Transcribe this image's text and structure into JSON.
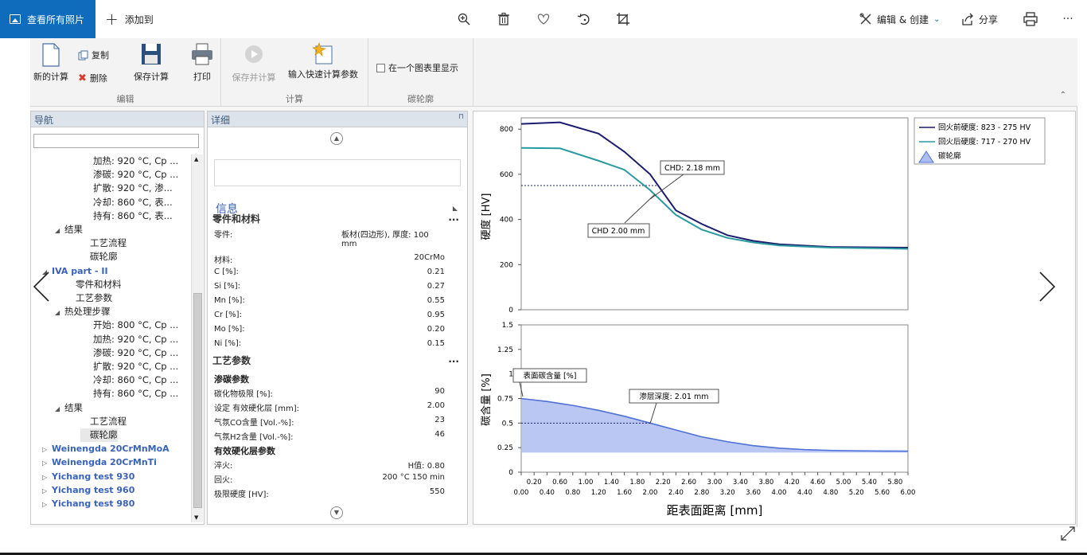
{
  "viewer": {
    "view_all_label": "查看所有照片",
    "add_to_label": "添加到",
    "edit_create_label": "编辑 & 创建",
    "share_label": "分享",
    "more_label": "···"
  },
  "ribbon": {
    "new_calc": "新的计算",
    "copy": "复制",
    "delete": "删除",
    "save_calc": "保存计算",
    "print": "打印",
    "save_and_calc": "保存并计算",
    "quick_params": "输入快速计算参数",
    "one_chart": "在一个图表里显示",
    "group_edit": "编辑",
    "group_calc": "计算",
    "group_profile": "碳轮廓"
  },
  "nav": {
    "title": "导航",
    "rows": [
      {
        "label": "加热: 920 °C,  Cp ...",
        "indent": 80,
        "tri": ""
      },
      {
        "label": "渗碳: 920 °C,  Cp ...",
        "indent": 80,
        "tri": ""
      },
      {
        "label": "扩散: 920 °C,  渗...",
        "indent": 80,
        "tri": ""
      },
      {
        "label": "冷却: 860 °C,  表...",
        "indent": 80,
        "tri": ""
      },
      {
        "label": "持有: 860 °C,  表...",
        "indent": 80,
        "tri": ""
      },
      {
        "label": "结果",
        "indent": 44,
        "tri": "◢"
      },
      {
        "label": "工艺流程",
        "indent": 76,
        "tri": ""
      },
      {
        "label": "碳轮廓",
        "indent": 76,
        "tri": ""
      },
      {
        "label": "IVA part - II",
        "indent": 28,
        "tri": "◢",
        "proj": true
      },
      {
        "label": "零件和材料",
        "indent": 58,
        "tri": ""
      },
      {
        "label": "工艺参数",
        "indent": 58,
        "tri": ""
      },
      {
        "label": "热处理步骤",
        "indent": 44,
        "tri": "◢"
      },
      {
        "label": "开始: 800 °C,  Cp ...",
        "indent": 80,
        "tri": ""
      },
      {
        "label": "加热: 920 °C,  Cp ...",
        "indent": 80,
        "tri": ""
      },
      {
        "label": "渗碳: 920 °C,  Cp ...",
        "indent": 80,
        "tri": ""
      },
      {
        "label": "扩散: 920 °C,  Cp ...",
        "indent": 80,
        "tri": ""
      },
      {
        "label": "冷却: 860 °C,  Cp ...",
        "indent": 80,
        "tri": ""
      },
      {
        "label": "持有: 860 °C,  Cp ...",
        "indent": 80,
        "tri": ""
      },
      {
        "label": "结果",
        "indent": 44,
        "tri": "◢"
      },
      {
        "label": "工艺流程",
        "indent": 76,
        "tri": ""
      },
      {
        "label": "碳轮廓",
        "indent": 76,
        "tri": "",
        "sel": true
      },
      {
        "label": "Weinengda 20CrMnMoA",
        "indent": 28,
        "tri": "▷",
        "proj": true
      },
      {
        "label": "Weinengda 20CrMnTi",
        "indent": 28,
        "tri": "▷",
        "proj": true
      },
      {
        "label": "Yichang test 930",
        "indent": 28,
        "tri": "▷",
        "proj": true
      },
      {
        "label": "Yichang test 960",
        "indent": 28,
        "tri": "▷",
        "proj": true
      },
      {
        "label": "Yichang test 980",
        "indent": 28,
        "tri": "▷",
        "proj": true
      }
    ]
  },
  "details": {
    "title": "详细",
    "info": "信息",
    "section_part": "零件和材料",
    "part_rows": [
      {
        "k": "零件:",
        "v": "板材(四边形), 厚度: 100 mm"
      },
      {
        "k": "材料:",
        "v": "20CrMo"
      },
      {
        "k": "C [%]:",
        "v": "0.21"
      },
      {
        "k": "Si [%]:",
        "v": "0.27"
      },
      {
        "k": "Mn [%]:",
        "v": "0.55"
      },
      {
        "k": "Cr [%]:",
        "v": "0.95"
      },
      {
        "k": "Mo [%]:",
        "v": "0.20"
      },
      {
        "k": "Ni [%]:",
        "v": "0.15"
      }
    ],
    "section_process": "工艺参数",
    "sub_carb": "渗碳参数",
    "carb_rows": [
      {
        "k": "碳化物极限 [%]:",
        "v": "90"
      },
      {
        "k": " 设定 有效硬化层 [mm]:",
        "v": "2.00"
      },
      {
        "k": "气氛CO含量 [Vol.-%]:",
        "v": "23"
      },
      {
        "k": "气氛H2含量 [Vol.-%]:",
        "v": "46"
      }
    ],
    "sub_chd": "有效硬化层参数",
    "chd_rows": [
      {
        "k": "淬火:",
        "v": "H值: 0.80"
      },
      {
        "k": "回火:",
        "v": "200 °C 150 min"
      },
      {
        "k": "极限硬度 [HV]:",
        "v": "550"
      }
    ]
  },
  "chart_data": [
    {
      "type": "line",
      "title": "",
      "ylabel": "硬度 [HV]",
      "ylim": [
        0,
        850
      ],
      "yticks": [
        0,
        200,
        400,
        600,
        800
      ],
      "xlim": [
        0,
        6
      ],
      "legend": "top-right",
      "series": [
        {
          "name": "回火前硬度: 823 - 275 HV",
          "color": "#1c1c6e",
          "x": [
            0,
            0.6,
            1.2,
            1.6,
            2.0,
            2.4,
            2.8,
            3.2,
            3.6,
            4.0,
            4.8,
            5.6,
            6.0
          ],
          "y": [
            823,
            830,
            780,
            700,
            600,
            440,
            380,
            330,
            305,
            290,
            278,
            276,
            275
          ]
        },
        {
          "name": "回火后硬度: 717 - 270 HV",
          "color": "#2a9aa0",
          "x": [
            0,
            0.6,
            1.2,
            1.6,
            2.0,
            2.4,
            2.8,
            3.2,
            3.6,
            4.0,
            4.8,
            5.6,
            6.0
          ],
          "y": [
            717,
            715,
            660,
            620,
            530,
            420,
            355,
            318,
            298,
            285,
            275,
            272,
            270
          ]
        }
      ],
      "annotations": [
        "CHD: 2.18 mm",
        "CHD 2.00 mm"
      ],
      "limit_hardness": 550
    },
    {
      "type": "area",
      "ylabel": "碳含量 [%]",
      "xlabel": "距表面距离 [mm]",
      "ylim": [
        0,
        1.5
      ],
      "yticks": [
        0,
        0.25,
        0.5,
        0.75,
        1,
        1.25,
        1.5
      ],
      "ytick_labels": [
        "0",
        "0.25",
        "0.5",
        "0.75",
        "1",
        "1.25",
        "1.5"
      ],
      "xlim": [
        0,
        6
      ],
      "xticks_upper": [
        "0.20",
        "0.60",
        "1.00",
        "1.40",
        "1.80",
        "2.20",
        "2.60",
        "3.00",
        "3.40",
        "3.80",
        "4.20",
        "4.60",
        "5.00",
        "5.40",
        "5.80"
      ],
      "xticks_lower": [
        "0.00",
        "0.40",
        "0.80",
        "1.20",
        "1.60",
        "2.00",
        "2.40",
        "2.80",
        "3.20",
        "3.60",
        "4.00",
        "4.40",
        "4.80",
        "5.20",
        "5.60",
        "6.00"
      ],
      "series": [
        {
          "name": "碳轮廓",
          "color": "#4f70d8",
          "x": [
            0,
            0.4,
            0.8,
            1.2,
            1.6,
            2.0,
            2.4,
            2.8,
            3.2,
            3.6,
            4.0,
            4.4,
            4.8,
            5.2,
            5.6,
            6.0
          ],
          "y": [
            0.75,
            0.72,
            0.68,
            0.63,
            0.57,
            0.5,
            0.43,
            0.36,
            0.31,
            0.27,
            0.245,
            0.23,
            0.222,
            0.218,
            0.215,
            0.214
          ]
        }
      ],
      "annotations": [
        "表面碳含量 [%]",
        "渗层深度: 2.01 mm"
      ],
      "case_depth_level": 0.5
    }
  ],
  "colors": {
    "accent": "#0f6cbd",
    "project_link": "#3a62b8"
  }
}
